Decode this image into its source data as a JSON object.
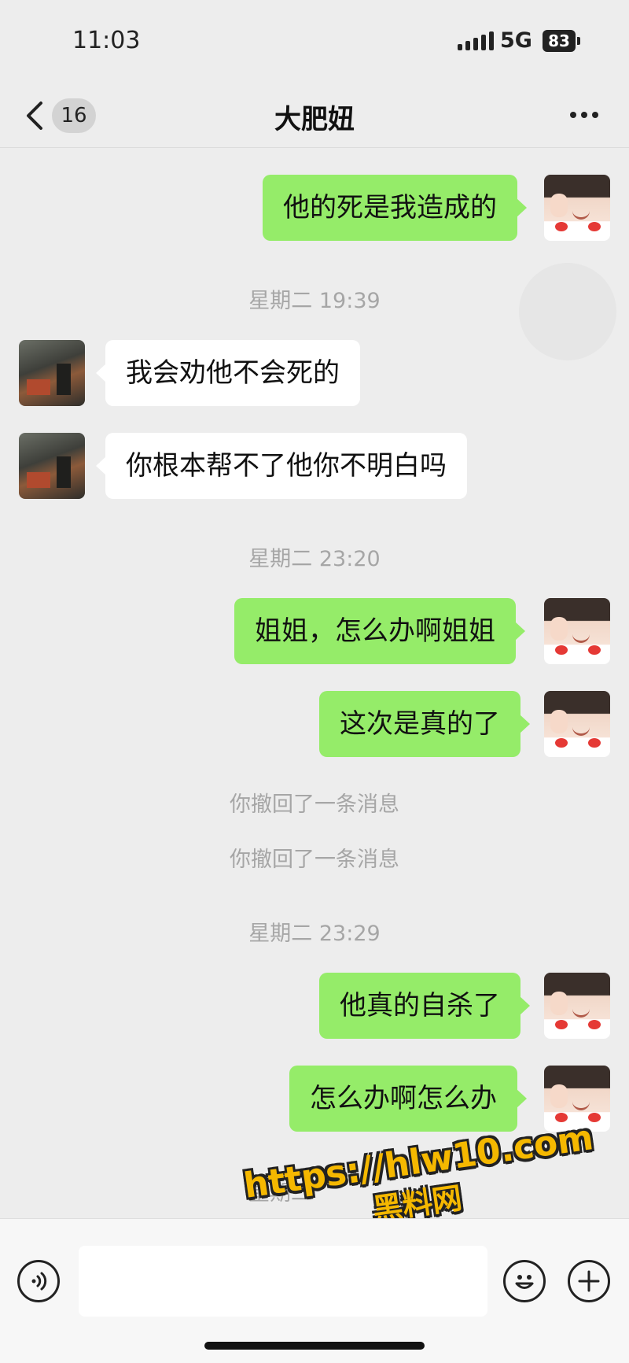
{
  "status": {
    "time": "11:03",
    "network": "5G",
    "battery": "83"
  },
  "header": {
    "unread_count": "16",
    "title": "大肥妞"
  },
  "messages": [
    {
      "text": "他的死是我造成的"
    },
    {
      "text": "星期二 19:39"
    },
    {
      "text": "我会劝他不会死的"
    },
    {
      "text": "你根本帮不了他你不明白吗"
    },
    {
      "text": "星期二 23:20"
    },
    {
      "text": "姐姐，怎么办啊姐姐"
    },
    {
      "text": "这次是真的了"
    },
    {
      "text": "你撤回了一条消息"
    },
    {
      "text": "你撤回了一条消息"
    },
    {
      "text": "星期二 23:29"
    },
    {
      "text": "他真的自杀了"
    },
    {
      "text": "怎么办啊怎么办"
    },
    {
      "text": "星期二"
    }
  ],
  "watermark": {
    "url": "https://hlw10.com",
    "name": "黑料网"
  },
  "colors": {
    "outgoing_bubble": "#95ec69",
    "incoming_bubble": "#ffffff",
    "background": "#ededed"
  },
  "icons": [
    "back-chevron-icon",
    "more-icon",
    "voice-icon",
    "emoji-icon",
    "plus-icon"
  ]
}
